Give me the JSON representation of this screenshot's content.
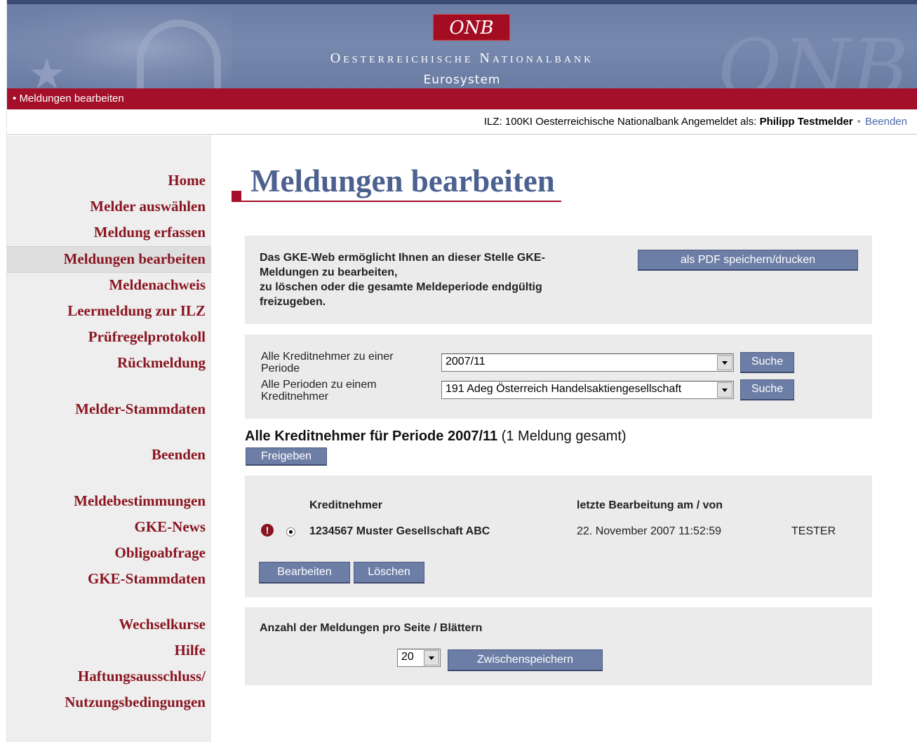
{
  "header": {
    "logo": "ONB",
    "bank_name": "Oesterreichische Nationalbank",
    "subtitle": "Eurosystem"
  },
  "redbar": {
    "breadcrumb": "Meldungen bearbeiten"
  },
  "userbar": {
    "ilz_text": "ILZ: 100KI Oesterreichische Nationalbank Angemeldet als:",
    "user": "Philipp Testmelder",
    "logout": "Beenden"
  },
  "sidebar": {
    "items": [
      {
        "label": "Home"
      },
      {
        "label": "Melder auswählen"
      },
      {
        "label": "Meldung erfassen"
      },
      {
        "label": "Meldungen bearbeiten",
        "active": true
      },
      {
        "label": "Meldenachweis"
      },
      {
        "label": "Leermeldung zur ILZ"
      },
      {
        "label": "Prüfregelprotokoll"
      },
      {
        "label": "Rückmeldung"
      },
      {
        "label": "Melder-Stammdaten"
      },
      {
        "label": "Beenden"
      },
      {
        "label": "Meldebestimmungen"
      },
      {
        "label": "GKE-News"
      },
      {
        "label": "Obligoabfrage"
      },
      {
        "label": "GKE-Stammdaten"
      },
      {
        "label": "Wechselkurse"
      },
      {
        "label": "Hilfe"
      },
      {
        "label": "Haftungsausschluss/"
      },
      {
        "label": "Nutzungsbedingungen"
      }
    ]
  },
  "main": {
    "title": "Meldungen bearbeiten",
    "intro": {
      "line1": "Das GKE-Web ermöglicht Ihnen an dieser Stelle GKE-",
      "line2": "Meldungen zu bearbeiten,",
      "line3": "zu löschen oder die gesamte Meldeperiode endgültig",
      "line4": "freizugeben.",
      "pdf_button": "als PDF speichern/drucken"
    },
    "search": {
      "row1_label_a": "Alle Kreditnehmer zu einer",
      "row1_label_b": "Periode",
      "row1_value": "2007/11",
      "row1_button": "Suche",
      "row2_label_a": "Alle Perioden zu einem",
      "row2_label_b": "Kreditnehmer",
      "row2_value": "191 Adeg Österreich Handelsaktiengesellschaft",
      "row2_button": "Suche"
    },
    "results": {
      "heading": "Alle Kreditnehmer für Periode 2007/11",
      "count": "(1 Meldung gesamt)",
      "release_button": "Freigeben",
      "col_creditor": "Kreditnehmer",
      "col_last_edit": "letzte Bearbeitung am / von",
      "row": {
        "creditor": "1234567 Muster Gesellschaft ABC",
        "date": "22. November 2007 11:52:59",
        "user": "TESTER"
      },
      "edit_button": "Bearbeiten",
      "delete_button": "Löschen"
    },
    "paging": {
      "label": "Anzahl der Meldungen pro Seite / Blättern",
      "per_page": "20",
      "save_button": "Zwischenspeichern"
    }
  },
  "colors": {
    "banner": "#6d7ea6",
    "accent_red": "#a4102a",
    "nav_text": "#8a1520",
    "title_blue": "#4d6191"
  }
}
